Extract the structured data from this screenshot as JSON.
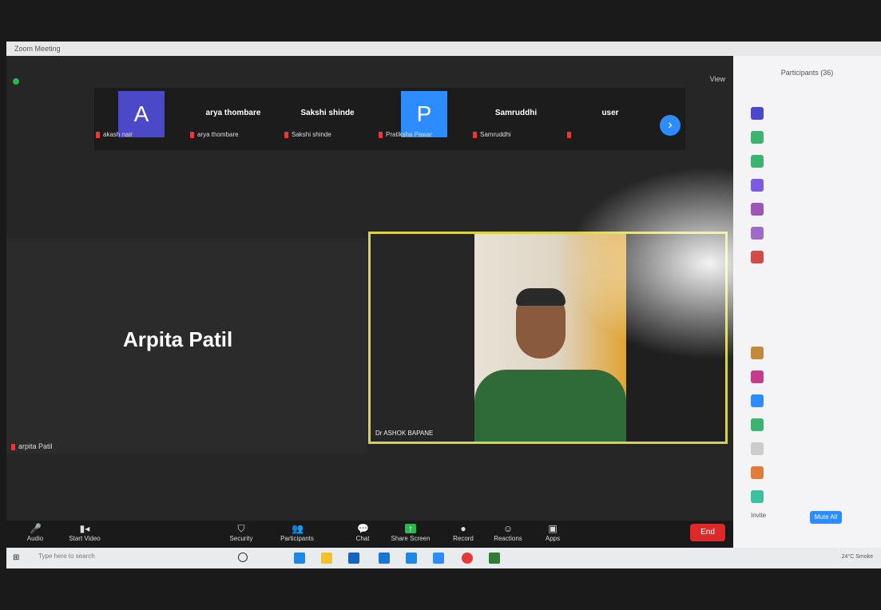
{
  "window": {
    "title": "Zoom Meeting",
    "view_label": "View"
  },
  "strip": {
    "thumbs": [
      {
        "avatar_letter": "A",
        "avatar_color": "#4b49c7",
        "name": "",
        "label": "akash nair"
      },
      {
        "avatar_letter": "",
        "avatar_color": "",
        "name": "arya thombare",
        "label": "arya thombare"
      },
      {
        "avatar_letter": "",
        "avatar_color": "",
        "name": "Sakshi shinde",
        "label": "Sakshi shinde"
      },
      {
        "avatar_letter": "P",
        "avatar_color": "#2d8cff",
        "name": "",
        "label": "Pratiksha Pawar"
      },
      {
        "avatar_letter": "",
        "avatar_color": "",
        "name": "Samruddhi",
        "label": "Samruddhi"
      },
      {
        "avatar_letter": "",
        "avatar_color": "",
        "name": "user",
        "label": ""
      }
    ],
    "next_icon": "chevron-right-icon"
  },
  "tiles": {
    "arpita": {
      "big_name": "Arpita Patil",
      "label": "arpita Patil"
    },
    "ashok": {
      "label": "Dr ASHOK BAPANE"
    }
  },
  "toolbar": {
    "items": [
      {
        "label": "Audio",
        "icon": "microphone-icon"
      },
      {
        "label": "Start Video",
        "icon": "video-icon"
      },
      {
        "label": "Security",
        "icon": "shield-icon"
      },
      {
        "label": "Participants",
        "icon": "people-icon",
        "count": "36"
      },
      {
        "label": "Chat",
        "icon": "chat-icon"
      },
      {
        "label": "Share Screen",
        "icon": "share-icon"
      },
      {
        "label": "Record",
        "icon": "record-icon"
      },
      {
        "label": "Reactions",
        "icon": "smile-icon"
      },
      {
        "label": "Apps",
        "icon": "apps-icon"
      }
    ],
    "end_label": "End"
  },
  "panel": {
    "header": "Participants (36)",
    "subheader": "",
    "items": [
      {
        "color": "#4b49c7",
        "name": ""
      },
      {
        "color": "#3cb371",
        "name": ""
      },
      {
        "color": "#3cb371",
        "name": ""
      },
      {
        "color": "#7b5ce0",
        "name": ""
      },
      {
        "color": "#9b59b6",
        "name": ""
      },
      {
        "color": "#a06ac8",
        "name": ""
      },
      {
        "color": "#d24b4b",
        "name": ""
      },
      {
        "color": "#c28b3b",
        "name": ""
      },
      {
        "color": "#c43d8a",
        "name": ""
      },
      {
        "color": "#2d8cff",
        "name": ""
      },
      {
        "color": "#3cb371",
        "name": ""
      },
      {
        "color": "#cccccc",
        "name": ""
      },
      {
        "color": "#e07b39",
        "name": ""
      },
      {
        "color": "#3cc0a0",
        "name": ""
      }
    ],
    "invite_label": "Invite",
    "mute_all_label": "Mute All"
  },
  "taskbar": {
    "search_placeholder": "Type here to search",
    "tray_text": "24°C Smoke"
  }
}
